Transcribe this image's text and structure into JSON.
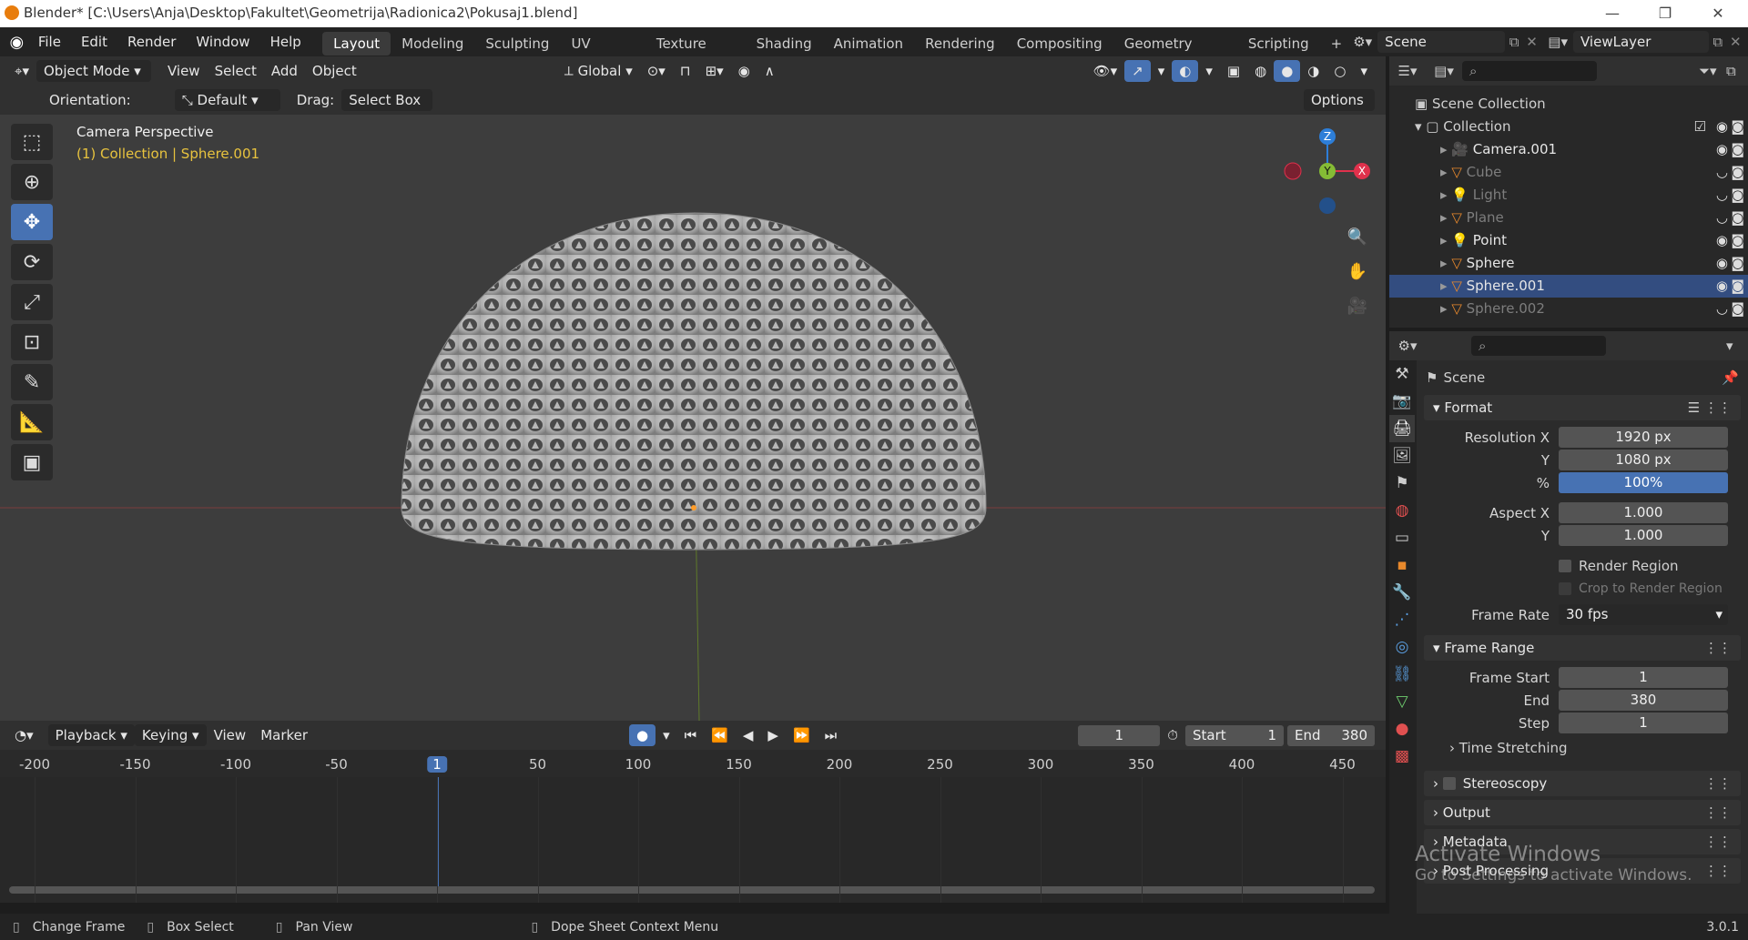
{
  "titlebar": {
    "title": "Blender* [C:\\Users\\Anja\\Desktop\\Fakultet\\Geometrija\\Radionica2\\Pokusaj1.blend]",
    "minimize": "—",
    "restore": "❐",
    "close": "✕"
  },
  "menu": {
    "items": [
      "File",
      "Edit",
      "Render",
      "Window",
      "Help"
    ],
    "workspaces": [
      "Layout",
      "Modeling",
      "Sculpting",
      "UV Editing",
      "Texture Paint",
      "Shading",
      "Animation",
      "Rendering",
      "Compositing",
      "Geometry Nodes",
      "Scripting"
    ],
    "active_workspace": "Layout",
    "add_workspace": "+",
    "scene": "Scene",
    "view_layer": "ViewLayer"
  },
  "viewport_header": {
    "mode": "Object Mode",
    "menus": [
      "View",
      "Select",
      "Add",
      "Object"
    ],
    "transform_orientation": "Global",
    "options": "Options"
  },
  "tool_settings": {
    "orientation_label": "Orientation:",
    "orientation_value": "Default",
    "drag_label": "Drag:",
    "drag_value": "Select Box"
  },
  "viewport": {
    "view_name": "Camera Perspective",
    "context": "(1) Collection | Sphere.001",
    "gizmo": {
      "z": "Z",
      "y": "Y",
      "x": "X"
    }
  },
  "outliner": {
    "root": "Scene Collection",
    "collection": "Collection",
    "items": [
      {
        "name": "Camera.001",
        "icon": "camera-icon",
        "visible": true,
        "selected": false
      },
      {
        "name": "Cube",
        "icon": "mesh-icon",
        "visible": false,
        "selected": false
      },
      {
        "name": "Light",
        "icon": "light-icon",
        "visible": false,
        "selected": false
      },
      {
        "name": "Plane",
        "icon": "mesh-icon",
        "visible": false,
        "selected": false
      },
      {
        "name": "Point",
        "icon": "light-icon",
        "visible": true,
        "selected": false
      },
      {
        "name": "Sphere",
        "icon": "mesh-icon",
        "visible": true,
        "selected": false
      },
      {
        "name": "Sphere.001",
        "icon": "mesh-icon",
        "visible": true,
        "selected": true
      },
      {
        "name": "Sphere.002",
        "icon": "mesh-icon",
        "visible": false,
        "selected": false
      }
    ]
  },
  "properties": {
    "context": "Scene",
    "format": {
      "title": "Format",
      "resolution_x_label": "Resolution X",
      "resolution_x": "1920 px",
      "y_label": "Y",
      "resolution_y": "1080 px",
      "percent_label": "%",
      "percent": "100%",
      "aspect_x_label": "Aspect X",
      "aspect_x": "1.000",
      "aspect_y_label": "Y",
      "aspect_y": "1.000",
      "render_region": "Render Region",
      "crop_region": "Crop to Render Region",
      "frame_rate_label": "Frame Rate",
      "frame_rate": "30 fps"
    },
    "frame_range": {
      "title": "Frame Range",
      "start_label": "Frame Start",
      "start": "1",
      "end_label": "End",
      "end": "380",
      "step_label": "Step",
      "step": "1"
    },
    "time_stretching": "Time Stretching",
    "stereoscopy": "Stereoscopy",
    "output": "Output",
    "metadata": "Metadata",
    "post_processing": "Post Processing"
  },
  "timeline": {
    "menus": [
      "Playback",
      "Keying",
      "View",
      "Marker"
    ],
    "current_frame": "1",
    "start_label": "Start",
    "start": "1",
    "end_label": "End",
    "end": "380",
    "ruler": [
      "-200",
      "-150",
      "-100",
      "-50",
      "1",
      "50",
      "100",
      "150",
      "200",
      "250",
      "300",
      "350",
      "400",
      "450"
    ]
  },
  "statusbar": {
    "change_frame": "Change Frame",
    "box_select": "Box Select",
    "pan_view": "Pan View",
    "context_menu": "Dope Sheet Context Menu",
    "version": "3.0.1"
  },
  "watermark": {
    "title": "Activate Windows",
    "subtitle": "Go to Settings to activate Windows."
  },
  "colors": {
    "accent": "#4772b3",
    "selected_row": "#334d80",
    "context_text": "#e8c33e",
    "gizmo_x": "#e0314c",
    "gizmo_y": "#85bc35",
    "gizmo_z": "#2d7ed8"
  }
}
